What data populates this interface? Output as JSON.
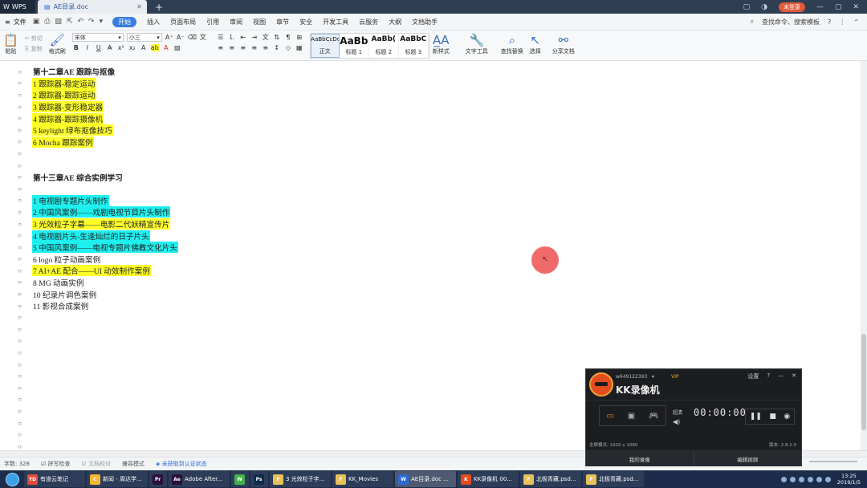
{
  "titlebar": {
    "app_tab": "WPS",
    "doc_tab": "AE目录.doc",
    "login": "未登录"
  },
  "menubar": {
    "file": "文件",
    "items": [
      "开始",
      "插入",
      "页面布局",
      "引用",
      "审阅",
      "视图",
      "章节",
      "安全",
      "开发工具",
      "云服务",
      "大纲",
      "文档助手"
    ],
    "active_index": 0,
    "search": "查找命令、搜索模板"
  },
  "ribbon": {
    "paste": "粘贴",
    "cut": "剪切",
    "copy": "复制",
    "format_painter": "格式刷",
    "font_name": "宋体",
    "font_size": "小三",
    "styles": [
      {
        "sample": "AaBbCcDd",
        "label": "正文"
      },
      {
        "sample": "AaBb",
        "label": "标题 1"
      },
      {
        "sample": "AaBb(",
        "label": "标题 2"
      },
      {
        "sample": "AaBbC",
        "label": "标题 3"
      }
    ],
    "new_style": "新样式",
    "text_tools": "文字工具",
    "find_replace": "查找替换",
    "select": "选择",
    "share": "分享文档"
  },
  "document": {
    "lines": [
      {
        "text": "第十二章AE 跟踪与抠像",
        "hl": "",
        "bold": true
      },
      {
        "text": "1  跟踪器-稳定运动",
        "hl": "yellow",
        "bold": false
      },
      {
        "text": "2  跟踪器-跟踪运动",
        "hl": "yellow",
        "bold": false
      },
      {
        "text": "3  跟踪器-变形稳定器",
        "hl": "yellow",
        "bold": false
      },
      {
        "text": "4  跟踪器-跟踪摄像机",
        "hl": "yellow",
        "bold": false
      },
      {
        "text": "5 keylight 绿布抠像技巧",
        "hl": "yellow",
        "bold": false
      },
      {
        "text": "6    Mocha 跟踪案例",
        "hl": "yellow",
        "bold": false
      },
      {
        "text": "",
        "hl": "",
        "bold": false
      },
      {
        "text": "",
        "hl": "",
        "bold": false
      },
      {
        "text": "第十三章AE 综合实例学习",
        "hl": "",
        "bold": true
      },
      {
        "text": "",
        "hl": "",
        "bold": false
      },
      {
        "text": "1  电视剧专题片头制作",
        "hl": "cyan",
        "bold": false
      },
      {
        "text": "2  中国风案例——戏剧电视节目片头制作",
        "hl": "cyan",
        "bold": false
      },
      {
        "text": "3  光效粒子字幕——电影二代妖精宣传片",
        "hl": "yellow",
        "bold": false
      },
      {
        "text": "4  电视剧片头-生逢灿烂的日子片头",
        "hl": "cyan",
        "bold": false
      },
      {
        "text": "5  中国风案例——电视专题片佛教文化片头",
        "hl": "cyan",
        "bold": false
      },
      {
        "text": "6 logo 粒子动画案例",
        "hl": "",
        "bold": false
      },
      {
        "text": "7 AI+AE 配合——UI 动效制作案例",
        "hl": "yellow",
        "bold": false
      },
      {
        "text": "8 MG 动画实例",
        "hl": "",
        "bold": false
      },
      {
        "text": "10  纪录片调色案例",
        "hl": "",
        "bold": false
      },
      {
        "text": "11  影视合成案例",
        "hl": "",
        "bold": false
      },
      {
        "text": "",
        "hl": "",
        "bold": false
      },
      {
        "text": "",
        "hl": "",
        "bold": false
      },
      {
        "text": "",
        "hl": "",
        "bold": false
      },
      {
        "text": "",
        "hl": "",
        "bold": false
      },
      {
        "text": "",
        "hl": "",
        "bold": false
      },
      {
        "text": "",
        "hl": "",
        "bold": false
      },
      {
        "text": "",
        "hl": "",
        "bold": false
      },
      {
        "text": "",
        "hl": "",
        "bold": false
      },
      {
        "text": "",
        "hl": "",
        "bold": false
      },
      {
        "text": "",
        "hl": "",
        "bold": false
      },
      {
        "text": "",
        "hl": "",
        "bold": false
      },
      {
        "text": "",
        "hl": "",
        "bold": false
      }
    ]
  },
  "statusbar": {
    "word_count": "字数: 328",
    "spell_check": "拼写检查",
    "doc_check": "文档校对",
    "compat_mode": "兼容模式",
    "auth": "未获取到认证状态"
  },
  "kk": {
    "user": "w649122393",
    "vip": "VIP",
    "title": "KK录像机",
    "settings": "设置",
    "quality": "超清",
    "time": "00:00:00",
    "mode_info": "全屏模式: 1920 x 1080",
    "version": "版本: 2.8.1.0",
    "my_recordings": "我的录像",
    "edit_video": "编辑视频"
  },
  "taskbar": {
    "items": [
      {
        "label": "有道云笔记",
        "icon": "YD",
        "color": "#e04b3a"
      },
      {
        "label": "新闻 - 周达学...",
        "icon": "C",
        "color": "#f2b632"
      },
      {
        "label": "",
        "icon": "Pr",
        "color": "#2a0f3a"
      },
      {
        "label": "Adobe After...",
        "icon": "Ae",
        "color": "#2a0f3a"
      },
      {
        "label": "",
        "icon": "W",
        "color": "#3fb24a"
      },
      {
        "label": "",
        "icon": "Ps",
        "color": "#0c2b4a"
      },
      {
        "label": "3 光效粒子字...",
        "icon": "F",
        "color": "#e8c15a"
      },
      {
        "label": "KK_Movies",
        "icon": "F",
        "color": "#e8c15a"
      },
      {
        "label": "AE目录.doc ...",
        "icon": "W",
        "color": "#2b6bd6"
      },
      {
        "label": "KK录像机 00...",
        "icon": "K",
        "color": "#e34c1f"
      },
      {
        "label": "北极青藏.psd...",
        "icon": "F",
        "color": "#e8c15a"
      },
      {
        "label": "北极青藏.psd...",
        "icon": "F",
        "color": "#e8c15a"
      }
    ],
    "active_index": 8,
    "time": "13:25",
    "date": "2019/1/5"
  }
}
